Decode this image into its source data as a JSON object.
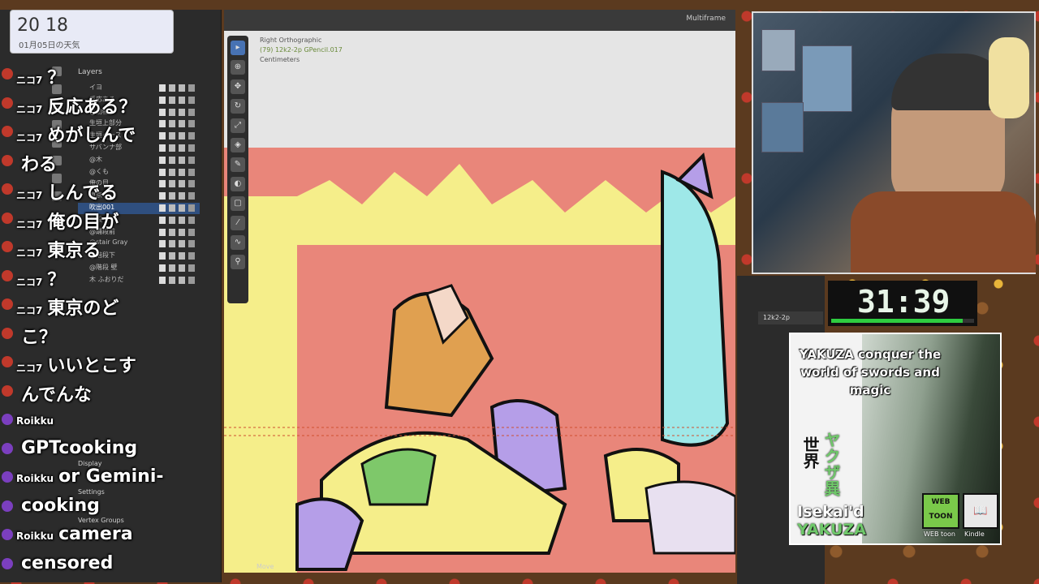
{
  "clock": {
    "time": "20 18",
    "weather": "01月05日の天気"
  },
  "outliner": {
    "header": "Layers",
    "layers": [
      "イヨ",
      "反応ある",
      "@動物",
      "生垣上部分",
      "生垣ベース",
      "サバンナ部",
      "@木",
      "@くも",
      "俺の目",
      "東京る",
      "吹出001",
      "階段",
      "@踊段前",
      "@stair Gray",
      "@階段下",
      "@階段 壁",
      "木 ふおりだ"
    ],
    "selected_index": 10,
    "sections": [
      "Display",
      "Settings",
      "Vertex Groups"
    ]
  },
  "chat": [
    {
      "user": "ニコ7",
      "m": "？",
      "badge": "red"
    },
    {
      "user": "ニコ7",
      "m": "反応ある？",
      "badge": "red"
    },
    {
      "user": "ニコ7",
      "m": "めがしんで",
      "badge": "red"
    },
    {
      "user": "",
      "m": "わる",
      "badge": "red"
    },
    {
      "user": "ニコ7",
      "m": "しんでる",
      "badge": "red"
    },
    {
      "user": "ニコ7",
      "m": "俺の目が",
      "badge": "red"
    },
    {
      "user": "ニコ7",
      "m": "東京る",
      "badge": "red"
    },
    {
      "user": "ニコ7",
      "m": "？",
      "badge": "red"
    },
    {
      "user": "ニコ7",
      "m": "東京のど",
      "badge": "red"
    },
    {
      "user": "",
      "m": "こ？",
      "badge": "red"
    },
    {
      "user": "ニコ7",
      "m": "いいとこす",
      "badge": "red"
    },
    {
      "user": "",
      "m": "んでんな",
      "badge": "red"
    },
    {
      "user": "Roikku",
      "m": "",
      "badge": "purple"
    },
    {
      "user": "",
      "m": "GPTcooking",
      "badge": "purple"
    },
    {
      "user": "Roikku",
      "m": "or Gemini-",
      "badge": "purple"
    },
    {
      "user": "",
      "m": "cooking",
      "badge": "purple"
    },
    {
      "user": "Roikku",
      "m": "camera",
      "badge": "purple"
    },
    {
      "user": "",
      "m": "censored",
      "badge": "purple"
    }
  ],
  "viewport": {
    "view": "Right Orthographic",
    "object": "(79) 12k2-2p GPencil.017",
    "units": "Centimeters",
    "multiframe": "Multiframe",
    "status": "Move"
  },
  "props": {
    "object_field": "12k2-2p"
  },
  "timer": {
    "time": "31:39",
    "progress": 0.92
  },
  "manga": {
    "title": "YAKUZA conquer the world of swords and magic",
    "jp_a": "世界",
    "jp_b": "ヤクザ異",
    "isekai": "Isekai'd",
    "yakuza": "YAKUZA",
    "webtoon_label": "WEB toon",
    "kindle_label": "Kindle"
  },
  "colors": {
    "accent": "#4772b3",
    "timer_green": "#2ecc40",
    "canvas": "#e08070"
  }
}
